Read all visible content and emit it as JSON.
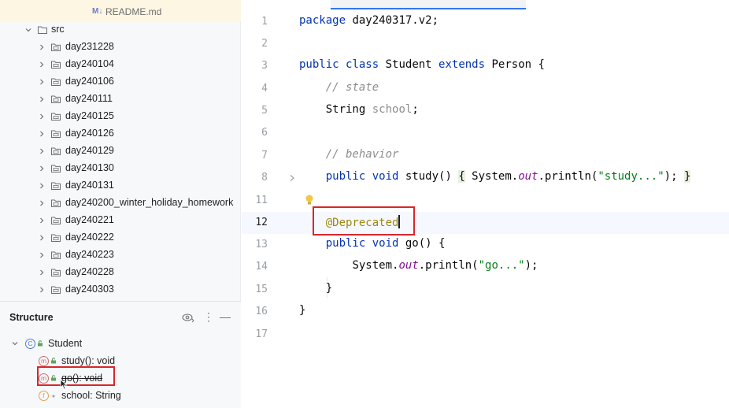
{
  "project_tree": {
    "readme": {
      "icon": "M↓",
      "label": "README.md"
    },
    "src_label": "src",
    "folders": [
      "day231228",
      "day240104",
      "day240106",
      "day240111",
      "day240125",
      "day240126",
      "day240129",
      "day240130",
      "day240131",
      "day240200_winter_holiday_homework",
      "day240221",
      "day240222",
      "day240223",
      "day240228",
      "day240303"
    ]
  },
  "structure": {
    "title": "Structure",
    "class_name": "Student",
    "class_badge": "C",
    "members": [
      {
        "badge": "m",
        "label": "study(): void",
        "deprecated": false
      },
      {
        "badge": "m",
        "label": "go(): void",
        "deprecated": true
      },
      {
        "badge": "f",
        "label": "school: String",
        "deprecated": false
      }
    ],
    "more_icon": "⋮",
    "minimize_icon": "—"
  },
  "editor": {
    "lines": [
      {
        "n": "1"
      },
      {
        "n": "2"
      },
      {
        "n": "3"
      },
      {
        "n": "4"
      },
      {
        "n": "5"
      },
      {
        "n": "6"
      },
      {
        "n": "7"
      },
      {
        "n": "8"
      },
      {
        "n": "11"
      },
      {
        "n": "12"
      },
      {
        "n": "13"
      },
      {
        "n": "14"
      },
      {
        "n": "15"
      },
      {
        "n": "16"
      },
      {
        "n": "17"
      }
    ],
    "code": {
      "l1_kw": "package",
      "l1_rest": " day240317.v2;",
      "l3_kw1": "public",
      "l3_kw2": "class",
      "l3_name": " Student ",
      "l3_kw3": "extends",
      "l3_rest": " Person {",
      "l4_comment": "// state",
      "l5_type": "String ",
      "l5_field": "school",
      "l5_end": ";",
      "l7_comment": "// behavior",
      "l8_kw1": "public",
      "l8_kw2": "void",
      "l8_name": " study() ",
      "l8_ob": "{",
      "l8_sys": " System.",
      "l8_out": "out",
      "l8_call": ".println(",
      "l8_str": "\"study...\"",
      "l8_end": "); ",
      "l8_cb": "}",
      "l12_ann": "@Deprecated",
      "l13_kw1": "public",
      "l13_kw2": "void",
      "l13_rest": " go() {",
      "l14_sys": "System.",
      "l14_out": "out",
      "l14_call": ".println(",
      "l14_str": "\"go...\"",
      "l14_end": ");",
      "l15": "}",
      "l16": "}"
    }
  },
  "colors": {
    "keyword": "#0033b3",
    "comment": "#8c8c8c",
    "field": "#871094",
    "string": "#067d17",
    "annotation": "#9e880d",
    "highlight_box": "#d9262a",
    "accent": "#3574f0"
  }
}
